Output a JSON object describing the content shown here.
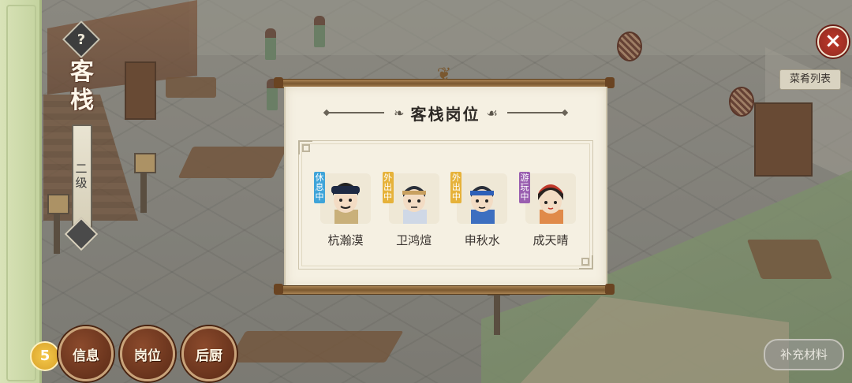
{
  "location": {
    "title": "客栈",
    "level": "二级",
    "help_icon": "?"
  },
  "top_right": {
    "menu_list_label": "菜肴列表"
  },
  "bottom_nav": {
    "info_label": "信息",
    "positions_label": "岗位",
    "kitchen_label": "后厨",
    "coin_label": "5"
  },
  "supply_button_label": "补充材料",
  "dialog": {
    "title": "客栈岗位",
    "staff": [
      {
        "name": "杭瀚漠",
        "status": "休息中",
        "status_color": "#3fa4d9"
      },
      {
        "name": "卫鸿煊",
        "status": "外出中",
        "status_color": "#e6b23a"
      },
      {
        "name": "申秋水",
        "status": "外出中",
        "status_color": "#e6b23a"
      },
      {
        "name": "成天晴",
        "status": "游玩中",
        "status_color": "#9a5fb0"
      }
    ]
  },
  "icons": {
    "close": "close-icon",
    "help": "help-icon",
    "level": "level-icon",
    "coin": "coin-icon"
  }
}
